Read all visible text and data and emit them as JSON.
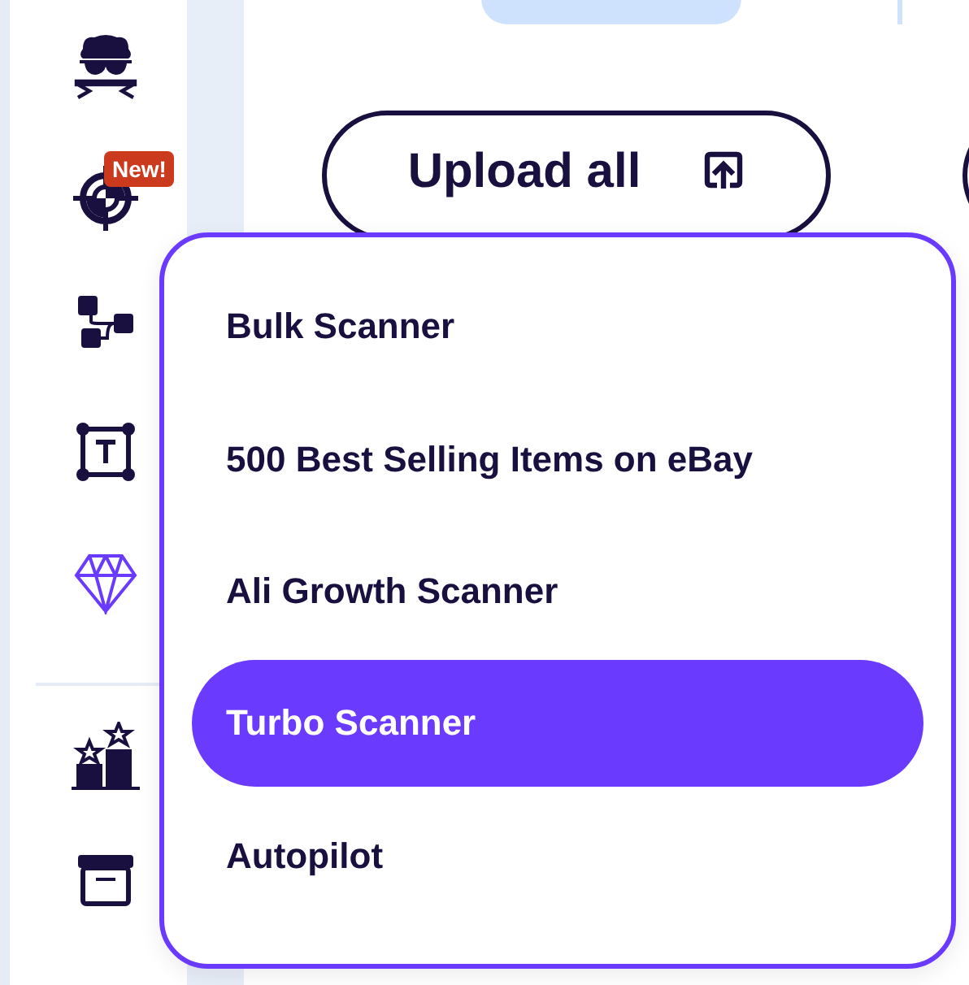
{
  "sidebar": {
    "badge": "New!"
  },
  "toolbar": {
    "upload_button": "Upload all"
  },
  "menu": {
    "items": [
      {
        "label": "Bulk Scanner",
        "selected": false
      },
      {
        "label": "500 Best Selling Items on eBay",
        "selected": false
      },
      {
        "label": "Ali Growth Scanner",
        "selected": false
      },
      {
        "label": "Turbo Scanner",
        "selected": true
      },
      {
        "label": "Autopilot",
        "selected": false
      }
    ]
  }
}
